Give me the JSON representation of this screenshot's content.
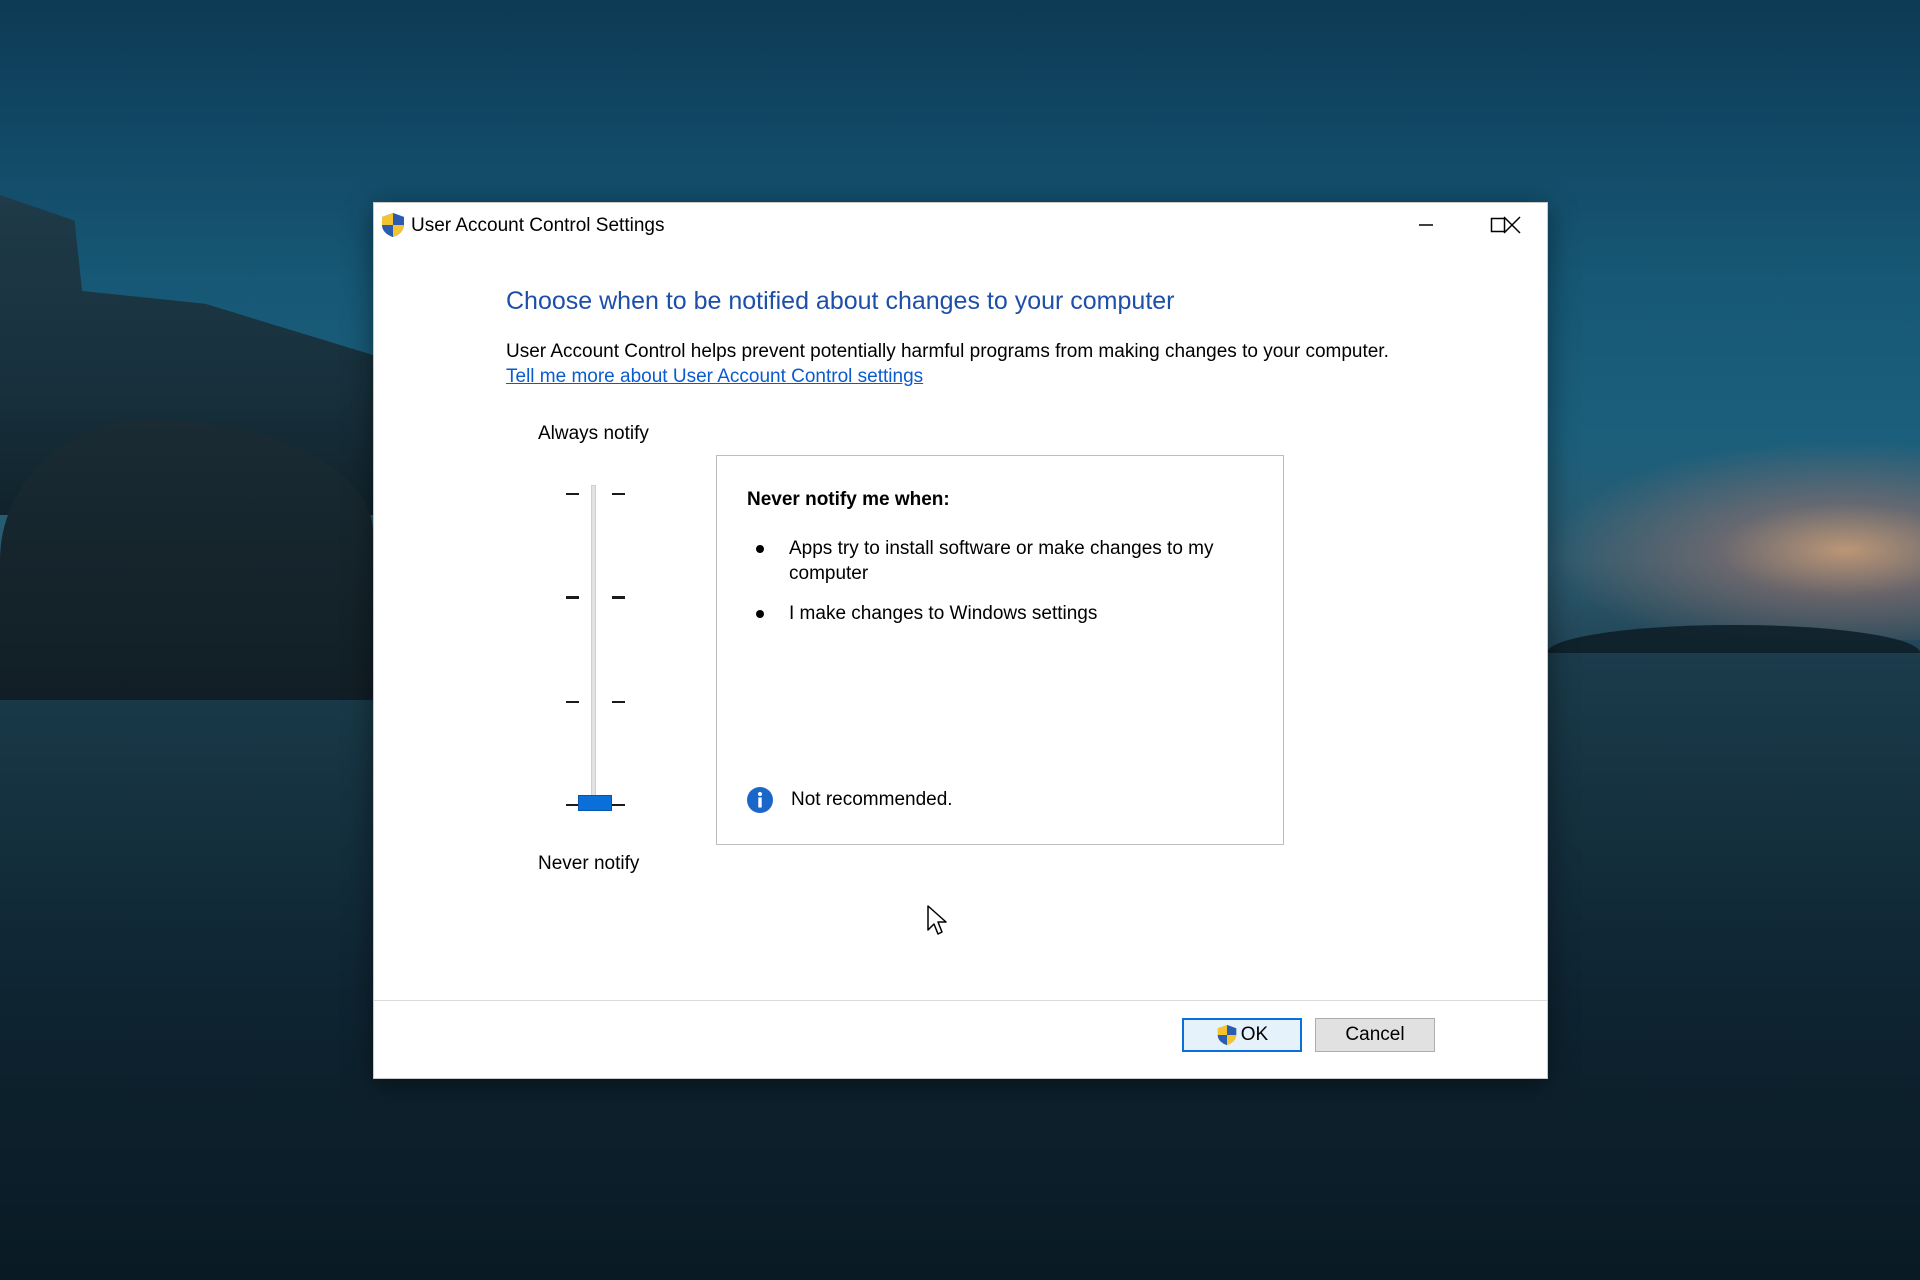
{
  "window": {
    "title": "User Account Control Settings",
    "icon": "uac-shield-icon",
    "controls": [
      "minimize-icon",
      "maximize-icon",
      "close-icon"
    ]
  },
  "main": {
    "heading": "Choose when to be notified about changes to your computer",
    "description": "User Account Control helps prevent potentially harmful programs from making changes to your computer.",
    "learn_more_link": "Tell me more about User Account Control settings"
  },
  "slider": {
    "top_label": "Always notify",
    "bottom_label": "Never notify",
    "levels": 4,
    "selected_level": 1
  },
  "info_panel": {
    "title": "Never notify me when:",
    "items": [
      "Apps try to install software or make changes to my computer",
      "I make changes to Windows settings"
    ],
    "note_icon": "info-icon",
    "note": "Not recommended."
  },
  "buttons": {
    "ok": "OK",
    "cancel": "Cancel"
  },
  "colors": {
    "heading": "#1e4fa8",
    "link": "#0a5bd0",
    "accent": "#0a6fd8"
  }
}
